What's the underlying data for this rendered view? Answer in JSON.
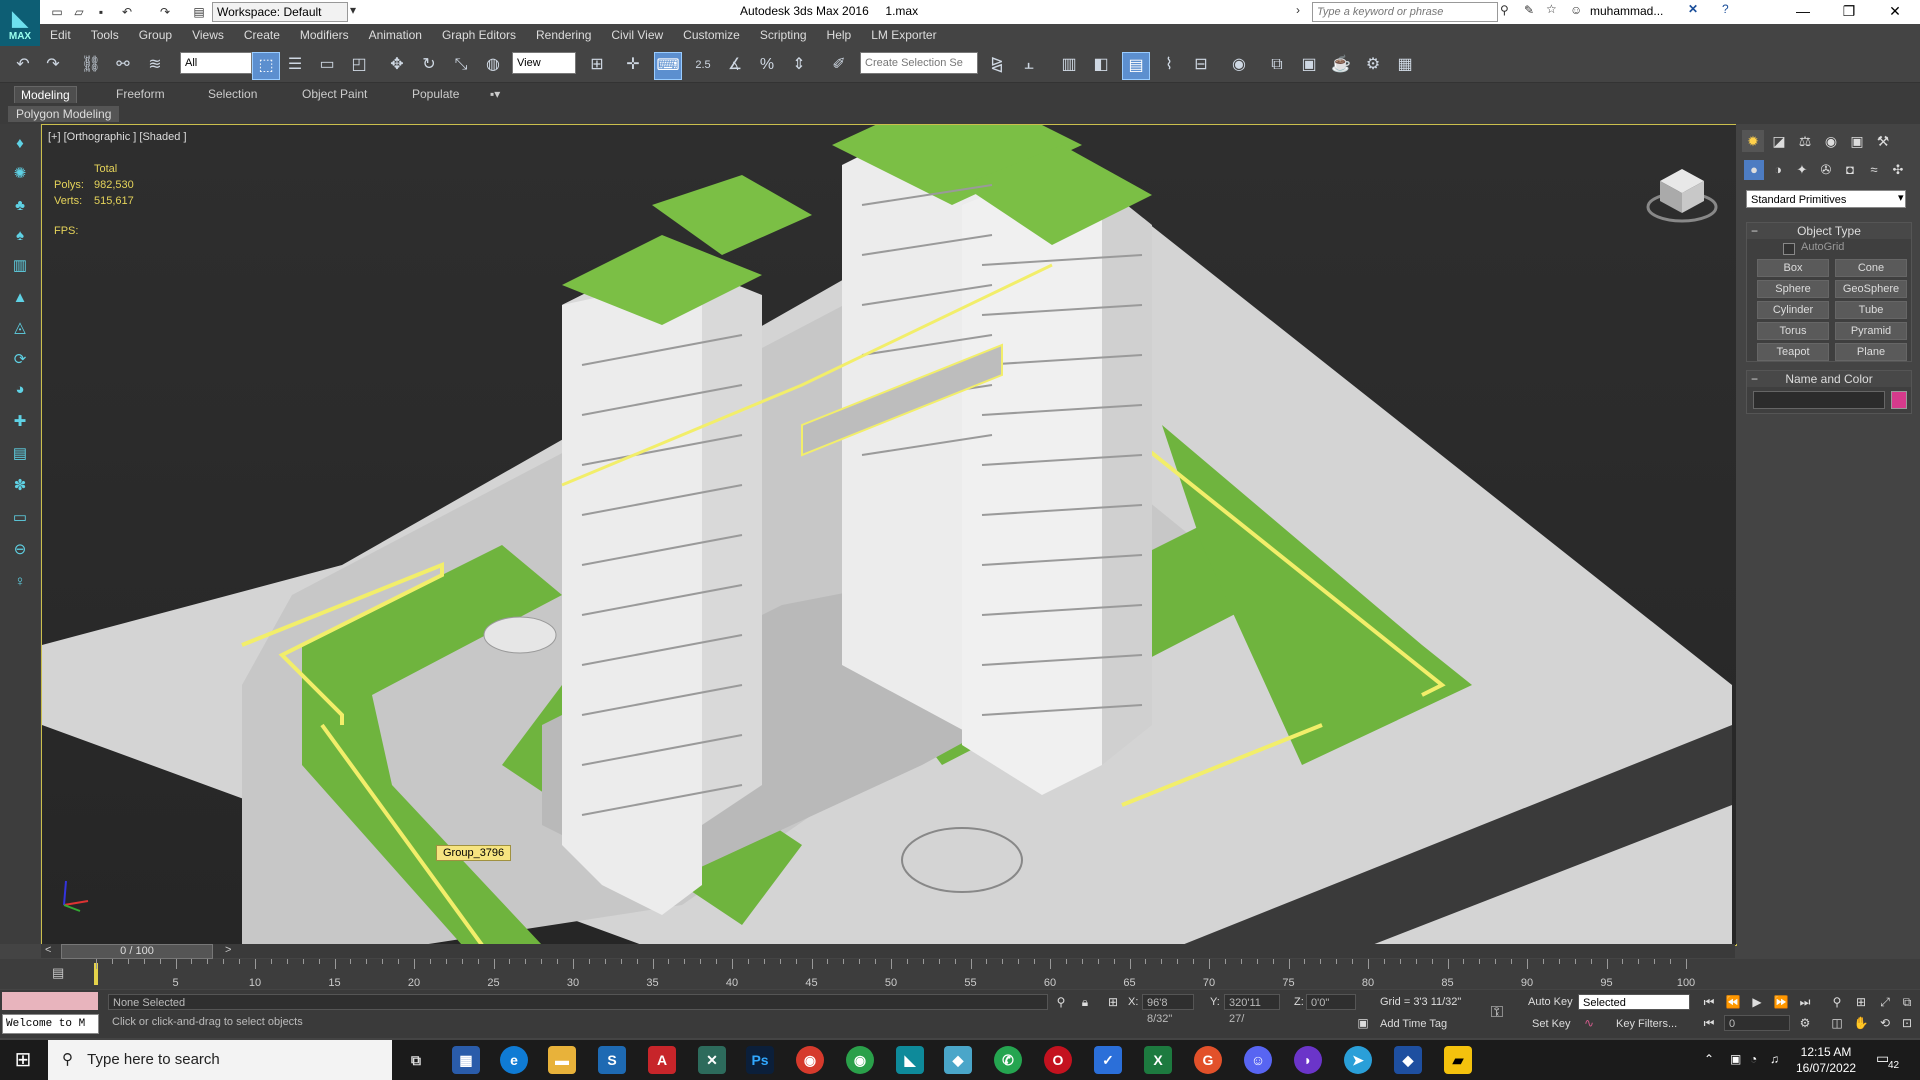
{
  "titlebar": {
    "workspace": "Workspace: Default",
    "app_title": "Autodesk 3ds Max 2016",
    "file_name": "1.max",
    "search_placeholder": "Type a keyword or phrase",
    "user": "muhammad..."
  },
  "logo_text": "MAX",
  "menu": [
    "Edit",
    "Tools",
    "Group",
    "Views",
    "Create",
    "Modifiers",
    "Animation",
    "Graph Editors",
    "Rendering",
    "Civil View",
    "Customize",
    "Scripting",
    "Help",
    "LM Exporter"
  ],
  "toolbar": {
    "selection_filter": "All",
    "ref_coord": "View",
    "snap_label": "2.5",
    "selection_set_placeholder": "Create Selection Se"
  },
  "ribbon": {
    "tabs": [
      "Modeling",
      "Freeform",
      "Selection",
      "Object Paint",
      "Populate"
    ],
    "sub_label": "Polygon Modeling"
  },
  "viewport": {
    "label": "[+] [Orthographic ] [Shaded ]",
    "stats_header": "Total",
    "polys_label": "Polys:",
    "polys_value": "982,530",
    "verts_label": "Verts:",
    "verts_value": "515,617",
    "fps_label": "FPS:",
    "tooltip": "Group_3796"
  },
  "command_panel": {
    "dropdown": "Standard Primitives",
    "object_type_title": "Object Type",
    "autogrid": "AutoGrid",
    "buttons": [
      "Box",
      "Cone",
      "Sphere",
      "GeoSphere",
      "Cylinder",
      "Tube",
      "Torus",
      "Pyramid",
      "Teapot",
      "Plane"
    ],
    "name_color_title": "Name and Color",
    "object_color": "#d63a8c"
  },
  "timeline": {
    "slider": "0 / 100",
    "ticks": [
      "5",
      "10",
      "15",
      "20",
      "25",
      "30",
      "35",
      "40",
      "45",
      "50",
      "55",
      "60",
      "65",
      "70",
      "75",
      "80",
      "85",
      "90",
      "95",
      "100"
    ]
  },
  "status": {
    "maxscript": "Welcome to M",
    "selection": "None Selected",
    "prompt": "Click or click-and-drag to select objects",
    "x_label": "X:",
    "x_value": "96'8 8/32\"",
    "y_label": "Y:",
    "y_value": "320'11 27/",
    "z_label": "Z:",
    "z_value": "0'0\"",
    "grid": "Grid = 3'3 11/32\"",
    "add_time_tag": "Add Time Tag",
    "auto_key": "Auto Key",
    "set_key": "Set Key",
    "key_mode": "Selected",
    "key_filters": "Key Filters...",
    "frame": "0"
  },
  "taskbar": {
    "search_placeholder": "Type here to search",
    "time": "12:15 AM",
    "date": "16/07/2022",
    "notifications": "42"
  }
}
